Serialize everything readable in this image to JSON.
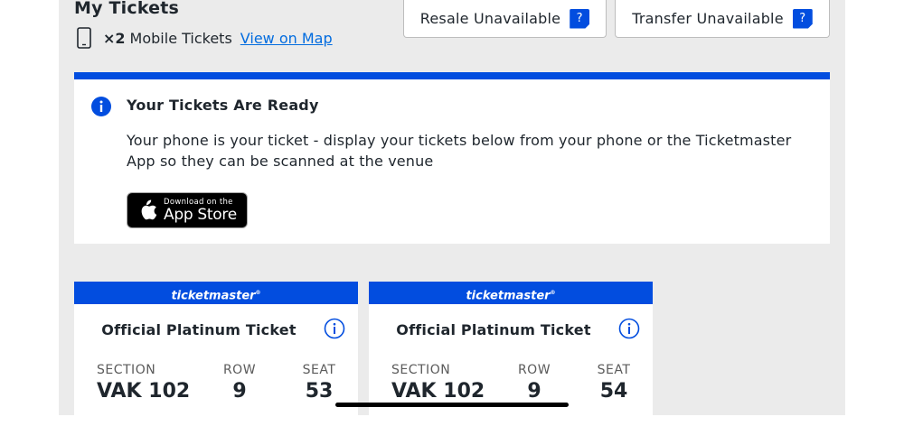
{
  "header": {
    "title": "My Tickets",
    "ticket_count": "×2",
    "ticket_type": "Mobile Tickets",
    "map_link": "View on Map",
    "phone_icon": "mobile-phone-icon"
  },
  "actions": {
    "resale_label": "Resale Unavailable",
    "transfer_label": "Transfer Unavailable",
    "help_badge": "?"
  },
  "notice": {
    "title": "Your Tickets Are Ready",
    "body": "Your phone is your ticket - display your tickets below from your phone or the Ticketmaster App so they can be scanned at the venue",
    "appstore_small": "Download on the",
    "appstore_large": "App Store"
  },
  "tickets": [
    {
      "brand": "ticketmaster",
      "title": "Official Platinum Ticket",
      "section_label": "SECTION",
      "section": "VAK 102",
      "row_label": "ROW",
      "row": "9",
      "seat_label": "SEAT",
      "seat": "53"
    },
    {
      "brand": "ticketmaster",
      "title": "Official Platinum Ticket",
      "section_label": "SECTION",
      "section": "VAK 102",
      "row_label": "ROW",
      "row": "9",
      "seat_label": "SEAT",
      "seat": "54"
    }
  ],
  "colors": {
    "accent": "#024ddf",
    "link": "#026cdf",
    "page_bg": "#ebebeb",
    "text": "#1f262d"
  }
}
